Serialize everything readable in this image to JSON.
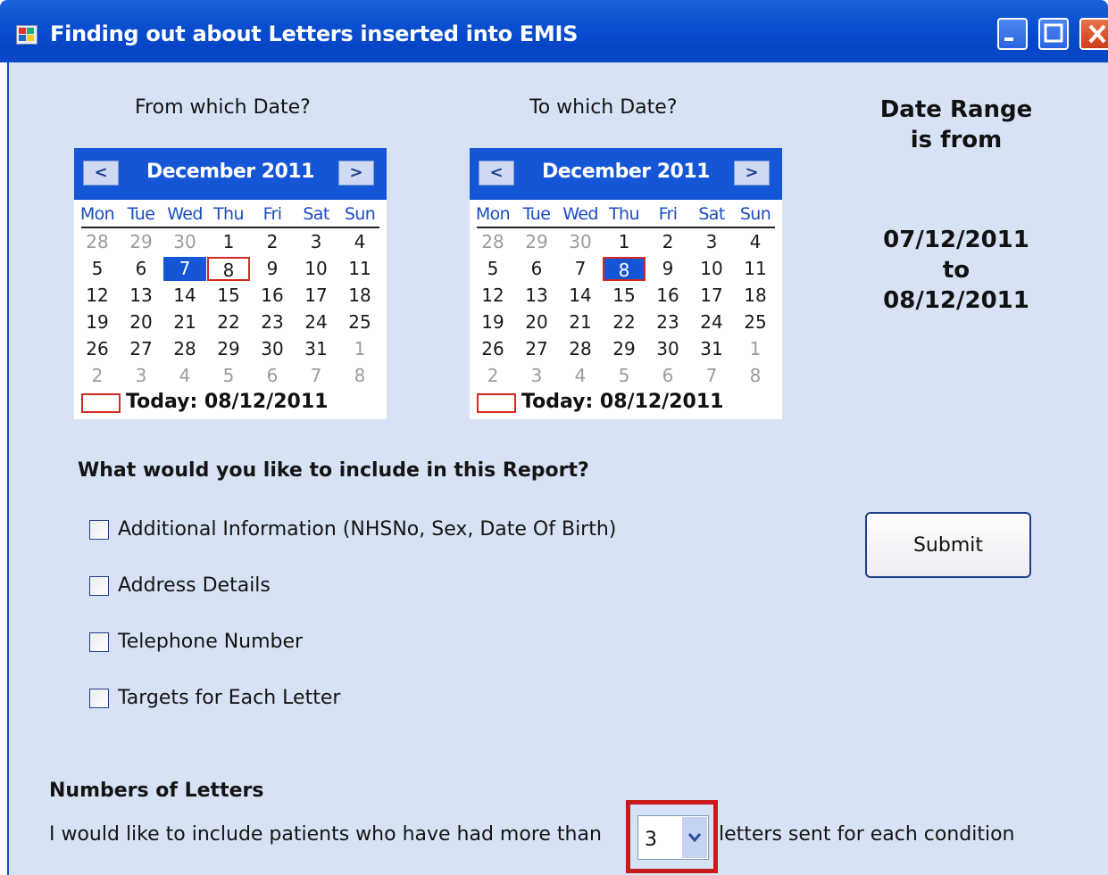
{
  "window": {
    "title": "Finding out about Letters inserted into EMIS"
  },
  "from_date": {
    "label": "From which Date?",
    "calendar": {
      "month": "December 2011",
      "prev": "<",
      "next": ">",
      "dow": [
        "Mon",
        "Tue",
        "Wed",
        "Thu",
        "Fri",
        "Sat",
        "Sun"
      ],
      "weeks": [
        [
          {
            "d": "28",
            "o": true
          },
          {
            "d": "29",
            "o": true
          },
          {
            "d": "30",
            "o": true
          },
          {
            "d": "1"
          },
          {
            "d": "2"
          },
          {
            "d": "3"
          },
          {
            "d": "4"
          }
        ],
        [
          {
            "d": "5"
          },
          {
            "d": "6"
          },
          {
            "d": "7",
            "s": true
          },
          {
            "d": "8",
            "t": true
          },
          {
            "d": "9"
          },
          {
            "d": "10"
          },
          {
            "d": "11"
          }
        ],
        [
          {
            "d": "12"
          },
          {
            "d": "13"
          },
          {
            "d": "14"
          },
          {
            "d": "15"
          },
          {
            "d": "16"
          },
          {
            "d": "17"
          },
          {
            "d": "18"
          }
        ],
        [
          {
            "d": "19"
          },
          {
            "d": "20"
          },
          {
            "d": "21"
          },
          {
            "d": "22"
          },
          {
            "d": "23"
          },
          {
            "d": "24"
          },
          {
            "d": "25"
          }
        ],
        [
          {
            "d": "26"
          },
          {
            "d": "27"
          },
          {
            "d": "28"
          },
          {
            "d": "29"
          },
          {
            "d": "30"
          },
          {
            "d": "31"
          },
          {
            "d": "1",
            "o": true
          }
        ],
        [
          {
            "d": "2",
            "o": true
          },
          {
            "d": "3",
            "o": true
          },
          {
            "d": "4",
            "o": true
          },
          {
            "d": "5",
            "o": true
          },
          {
            "d": "6",
            "o": true
          },
          {
            "d": "7",
            "o": true
          },
          {
            "d": "8",
            "o": true
          }
        ]
      ],
      "today": "Today: 08/12/2011"
    }
  },
  "to_date": {
    "label": "To which Date?",
    "calendar": {
      "month": "December 2011",
      "prev": "<",
      "next": ">",
      "dow": [
        "Mon",
        "Tue",
        "Wed",
        "Thu",
        "Fri",
        "Sat",
        "Sun"
      ],
      "weeks": [
        [
          {
            "d": "28",
            "o": true
          },
          {
            "d": "29",
            "o": true
          },
          {
            "d": "30",
            "o": true
          },
          {
            "d": "1"
          },
          {
            "d": "2"
          },
          {
            "d": "3"
          },
          {
            "d": "4"
          }
        ],
        [
          {
            "d": "5"
          },
          {
            "d": "6"
          },
          {
            "d": "7"
          },
          {
            "d": "8",
            "s": true,
            "t": true
          },
          {
            "d": "9"
          },
          {
            "d": "10"
          },
          {
            "d": "11"
          }
        ],
        [
          {
            "d": "12"
          },
          {
            "d": "13"
          },
          {
            "d": "14"
          },
          {
            "d": "15"
          },
          {
            "d": "16"
          },
          {
            "d": "17"
          },
          {
            "d": "18"
          }
        ],
        [
          {
            "d": "19"
          },
          {
            "d": "20"
          },
          {
            "d": "21"
          },
          {
            "d": "22"
          },
          {
            "d": "23"
          },
          {
            "d": "24"
          },
          {
            "d": "25"
          }
        ],
        [
          {
            "d": "26"
          },
          {
            "d": "27"
          },
          {
            "d": "28"
          },
          {
            "d": "29"
          },
          {
            "d": "30"
          },
          {
            "d": "31"
          },
          {
            "d": "1",
            "o": true
          }
        ],
        [
          {
            "d": "2",
            "o": true
          },
          {
            "d": "3",
            "o": true
          },
          {
            "d": "4",
            "o": true
          },
          {
            "d": "5",
            "o": true
          },
          {
            "d": "6",
            "o": true
          },
          {
            "d": "7",
            "o": true
          },
          {
            "d": "8",
            "o": true
          }
        ]
      ],
      "today": "Today: 08/12/2011"
    }
  },
  "range": {
    "heading_line1": "Date Range",
    "heading_line2": "is from",
    "from": "07/12/2011",
    "to_word": "to",
    "to": "08/12/2011"
  },
  "report": {
    "question": "What would you like to include in this Report?",
    "options": [
      "Additional Information (NHSNo, Sex, Date Of Birth)",
      "Address Details",
      "Telephone Number",
      "Targets for Each Letter"
    ]
  },
  "submit_label": "Submit",
  "letters": {
    "heading": "Numbers of Letters",
    "prefix": "I would like to include patients who have had more than",
    "value": "3",
    "suffix": "letters sent for each condition"
  },
  "colors": {
    "title_bar": "#0a4fd0",
    "client_bg": "#d7e3f5",
    "calendar_header": "#1556d6",
    "highlight": "#c8191b"
  }
}
